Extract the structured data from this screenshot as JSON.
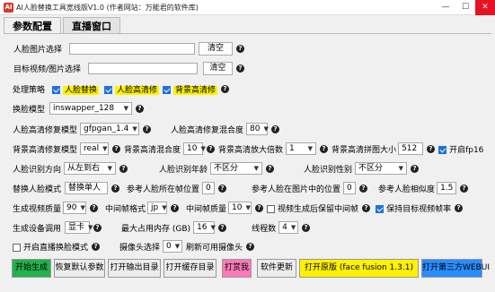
{
  "window": {
    "title": "AI人脸替换工具宽线版V1.0 (作者网站：万能君的软件库)",
    "min": "—",
    "max": "☐",
    "close": "✕"
  },
  "tabs": [
    "参数配置",
    "直播窗口"
  ],
  "face_image": {
    "label": "人脸图片选择",
    "value": "",
    "clear": "清空"
  },
  "target": {
    "label": "目标视频/图片选择",
    "value": "",
    "clear": "清空"
  },
  "strategy": {
    "label": "处理策略",
    "opts": [
      "人脸替换",
      "人脸高清修",
      "背景高清修"
    ]
  },
  "swap_model": {
    "label": "换脸模型",
    "value": "inswapper_128"
  },
  "enhance_model": {
    "label": "人脸高清修复模型",
    "value": "gfpgan_1.4"
  },
  "enhance_blend": {
    "label": "人脸高清修复混合度",
    "value": "80"
  },
  "bg_model": {
    "label": "背景高清修复模型",
    "value": "real"
  },
  "bg_blend": {
    "label": "背景高清混合度",
    "value": "10"
  },
  "bg_scale": {
    "label": "背景高清放大倍数",
    "value": "1"
  },
  "bg_tile": {
    "label": "背景高清拼图大小",
    "value": "512"
  },
  "fp16": {
    "label": "开启fp16"
  },
  "face_order": {
    "label": "人脸识别方向",
    "value": "从左到右"
  },
  "face_age": {
    "label": "人脸识别年龄",
    "value": "不区分"
  },
  "face_gender": {
    "label": "人脸识别性别",
    "value": "不区分"
  },
  "swap_mode": {
    "label": "替换人脸模式",
    "value": "替换单人"
  },
  "ref_frame": {
    "label": "参考人脸所在帧位置",
    "value": "0"
  },
  "ref_pos": {
    "label": "参考人脸在图片中的位置",
    "value": "0"
  },
  "ref_sim": {
    "label": "参考人脸相似度",
    "value": "1.5"
  },
  "quality": {
    "label": "生成视频质量",
    "value": "90"
  },
  "mid_fmt": {
    "label": "中间帧格式",
    "value": "jp"
  },
  "mid_quality": {
    "label": "中间帧质量",
    "value": "10"
  },
  "keep_frames": {
    "label": "视频生成后保留中间帧"
  },
  "keep_fps": {
    "label": "保持目标视频帧率"
  },
  "device": {
    "label": "生成设备调用",
    "value": "显卡"
  },
  "max_mem": {
    "label": "最大占用内存 (GB)",
    "value": "16"
  },
  "threads": {
    "label": "线程数",
    "value": "4"
  },
  "live": {
    "label": "开启直播换脸模式"
  },
  "camera": {
    "label": "摄像头选择",
    "value": "0",
    "refresh": "刷新可用摄像头"
  },
  "buttons": {
    "start": "开始生成",
    "reset": "恢复默认参数",
    "open_out": "打开输出目录",
    "open_cache": "打开缓存目录",
    "donate": "打赏我",
    "update": "软件更新",
    "orig": "打开原版 (face fusion 1.3.1)",
    "third": "打开第三方WEBUI"
  },
  "colors": {
    "start": "#22b14c",
    "donate": "#ff7ab8",
    "orig": "#fff200",
    "third": "#2a8cff"
  }
}
